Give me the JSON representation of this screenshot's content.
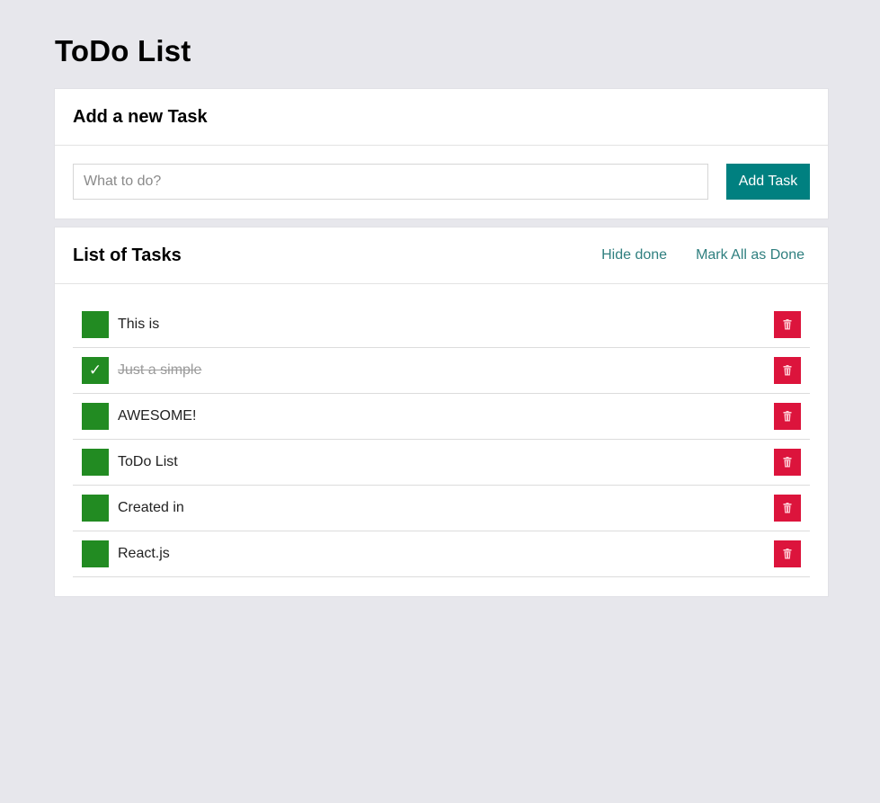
{
  "app": {
    "title": "ToDo List"
  },
  "add_task": {
    "heading": "Add a new Task",
    "input_value": "",
    "input_placeholder": "What to do?",
    "submit_label": "Add Task"
  },
  "task_list": {
    "heading": "List of Tasks",
    "hide_done_label": "Hide done",
    "mark_all_done_label": "Mark All as Done",
    "tasks": [
      {
        "text": "This is",
        "done": false
      },
      {
        "text": "Just a simple",
        "done": true
      },
      {
        "text": "AWESOME!",
        "done": false
      },
      {
        "text": "ToDo List",
        "done": false
      },
      {
        "text": "Created in",
        "done": false
      },
      {
        "text": "React.js",
        "done": false
      }
    ]
  },
  "icons": {
    "done_check": "✓",
    "delete": "trash-icon"
  },
  "colors": {
    "background": "#e7e7ec",
    "accent": "#008080",
    "toggle": "#228b22",
    "delete": "#dc143c",
    "link": "#2f7f7f"
  }
}
